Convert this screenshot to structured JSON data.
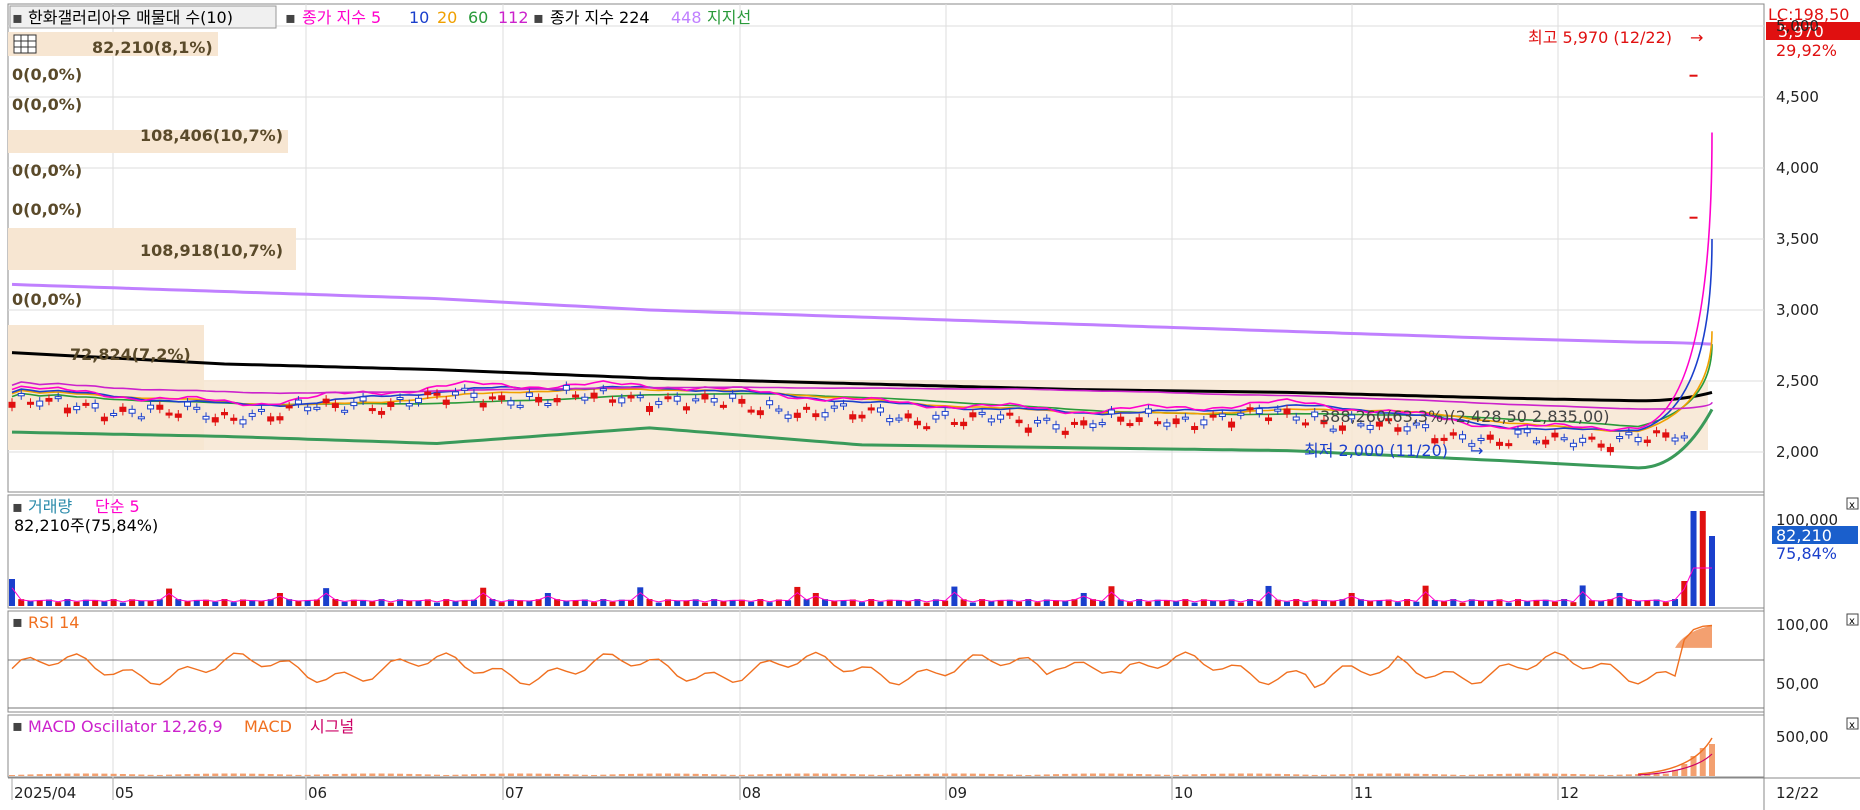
{
  "colors": {
    "up": "#e01010",
    "down": "#1a3fcc",
    "ma5": "#ff00cc",
    "ma10": "#1a3fcc",
    "ma20": "#f0a000",
    "ma60": "#2a9a3a",
    "ma112": "#cc22cc",
    "ma224": "#000000",
    "ma448": "#c080ff",
    "support": "#3a9a5a",
    "volband": "#f7e6d2",
    "rsi": "#f07020",
    "macd_osc": "#f3a070"
  },
  "price_panel": {
    "header": {
      "title": "한화갤러리아우 매물대 수(10)",
      "legend_prefix": "종가 지수 5",
      "legend_10": "10",
      "legend_20": "20",
      "legend_60": "60",
      "legend_112": "112",
      "legend_mid": "종가 지수 224",
      "legend_448": "448",
      "legend_support": "지지선"
    },
    "volume_profile": [
      "82,210(8,1%)",
      "0(0,0%)",
      "0(0,0%)",
      "108,406(10,7%)",
      "0(0,0%)",
      "0(0,0%)",
      "108,918(10,7%)",
      "0(0,0%)",
      "72,824(7,2%)"
    ],
    "high_label": "최고 5,970 (12/22)",
    "low_label": "최저 2,000 (11/20)",
    "overlay_values": "388,260(63,3%)(2,428,50    2,835,00)",
    "right_top_label": "LC:198,50",
    "current_price": "5,970",
    "current_change": "29,92%",
    "y_ticks": [
      "5,500",
      "5,000",
      "4,500",
      "4,000",
      "3,500",
      "3,000",
      "2,500",
      "2,000"
    ]
  },
  "volume_panel": {
    "label_a": "거래량",
    "label_b": "단순 5",
    "info": "82,210주(75,84%)",
    "y_tick": "100,000",
    "current": "82,210",
    "current_pct": "75,84%"
  },
  "rsi_panel": {
    "label": "RSI 14",
    "y_ticks": [
      "100,00",
      "50,00"
    ]
  },
  "macd_panel": {
    "label_a": "MACD Oscillator 12,26,9",
    "label_b": "MACD",
    "label_c": "시그널",
    "y_tick": "500,00"
  },
  "x_axis": {
    "labels": [
      "2025/04",
      "05",
      "06",
      "07",
      "08",
      "09",
      "10",
      "11",
      "12"
    ],
    "last": "12/22"
  },
  "chart_data": {
    "type": "line",
    "title": "한화갤러리아우",
    "series": [
      {
        "name": "종가",
        "x": [
          "2025/04",
          "05",
          "06",
          "07",
          "08",
          "09",
          "10",
          "11",
          "12",
          "12/22"
        ],
        "values": [
          2350,
          2250,
          2380,
          2380,
          2260,
          2200,
          2260,
          2080,
          2100,
          5970
        ]
      },
      {
        "name": "224",
        "x": [
          "2025/04",
          "05",
          "06",
          "07",
          "08",
          "09",
          "10",
          "11",
          "12",
          "12/22"
        ],
        "values": [
          2700,
          2620,
          2580,
          2520,
          2480,
          2440,
          2420,
          2380,
          2350,
          2400
        ]
      },
      {
        "name": "448",
        "x": [
          "2025/04",
          "05",
          "06",
          "07",
          "08",
          "09",
          "10",
          "11",
          "12",
          "12/22"
        ],
        "values": [
          3180,
          3130,
          3080,
          3000,
          2950,
          2900,
          2850,
          2800,
          2760,
          2750
        ]
      },
      {
        "name": "지지선",
        "x": [
          "2025/04",
          "05",
          "06",
          "07",
          "08",
          "09",
          "10",
          "11",
          "12",
          "12/22"
        ],
        "values": [
          2140,
          2110,
          2060,
          2170,
          2050,
          2030,
          2010,
          1940,
          1860,
          2300
        ]
      }
    ],
    "ylim": [
      1800,
      5700
    ],
    "high": 5970,
    "low": 2000
  }
}
